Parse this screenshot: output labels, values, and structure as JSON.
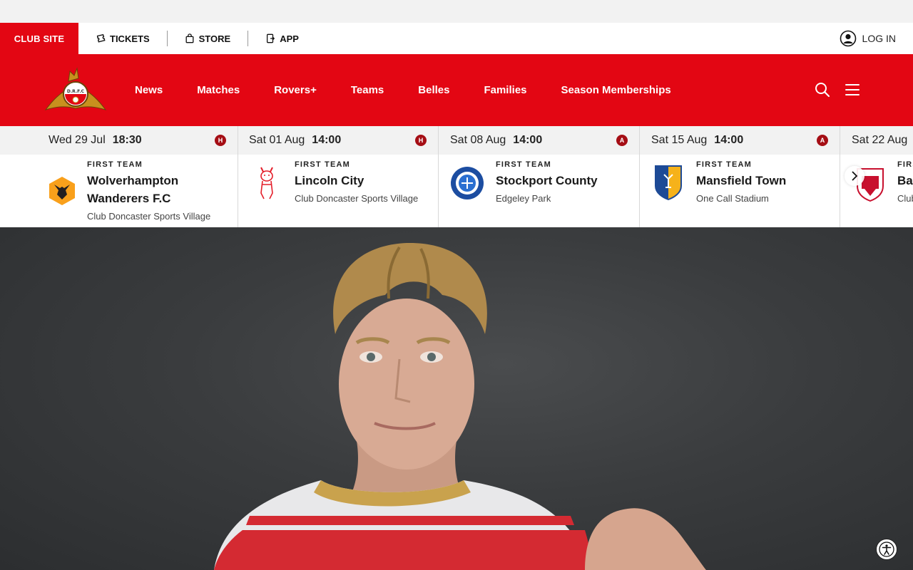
{
  "utility_bar": {
    "club_site": "CLUB SITE",
    "links": [
      {
        "label": "TICKETS",
        "icon": "ticket-icon"
      },
      {
        "label": "STORE",
        "icon": "bag-icon"
      },
      {
        "label": "APP",
        "icon": "phone-icon"
      }
    ],
    "login": "LOG IN"
  },
  "nav": {
    "crest_text": "D.R.F.C",
    "items": [
      "News",
      "Matches",
      "Rovers+",
      "Teams",
      "Belles",
      "Families",
      "Season Memberships"
    ]
  },
  "fixtures": [
    {
      "date": "Wed 29 Jul",
      "time": "18:30",
      "venue_type": "H",
      "label": "FIRST TEAM",
      "team": "Wolverhampton Wanderers F.C",
      "venue": "Club Doncaster Sports Village"
    },
    {
      "date": "Sat 01 Aug",
      "time": "14:00",
      "venue_type": "H",
      "label": "FIRST TEAM",
      "team": "Lincoln City",
      "venue": "Club Doncaster Sports Village"
    },
    {
      "date": "Sat 08 Aug",
      "time": "14:00",
      "venue_type": "A",
      "label": "FIRST TEAM",
      "team": "Stockport County",
      "venue": "Edgeley Park"
    },
    {
      "date": "Sat 15 Aug",
      "time": "14:00",
      "venue_type": "A",
      "label": "FIRST TEAM",
      "team": "Mansfield Town",
      "venue": "One Call Stadium"
    },
    {
      "date": "Sat 22 Aug",
      "time": "",
      "venue_type": "",
      "label": "FIRS",
      "team": "Bar",
      "venue": "Club"
    }
  ],
  "colors": {
    "brand_red": "#e30613",
    "badge_dark": "#a50e15"
  }
}
